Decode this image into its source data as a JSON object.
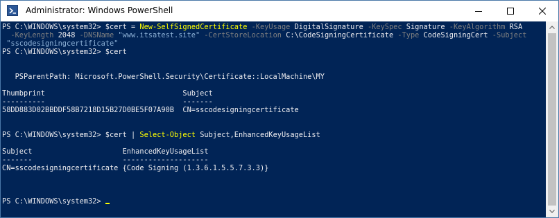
{
  "window": {
    "title": "Administrator: Windows PowerShell",
    "icon": "powershell-icon",
    "controls": [
      "minimize-icon",
      "maximize-icon",
      "close-icon"
    ]
  },
  "colors": {
    "background": "#012456",
    "command": "#ffff00",
    "parameter": "#808080",
    "text": "#eeedf0",
    "string": "#8fb3d8"
  },
  "console": {
    "cmd1": {
      "prompt": "PS C:\\WINDOWS\\system32> ",
      "var": "$cert",
      "eq": " = ",
      "cmdlet": "New-SelfSignedCertificate",
      "p_keyusage": " -KeyUsage",
      "v_keyusage": " DigitalSignature",
      "p_keyspec": " -KeySpec",
      "v_keyspec": " Signature",
      "p_keyalg": " -KeyAlgorithm",
      "v_keyalg": " RSA",
      "p_keylength": " -KeyLength",
      "v_keylength": " 2048",
      "p_dnsname": " -DNSName",
      "v_dnsname": " \"www.itsatest.site\"",
      "p_certstore": " -CertStoreLocation",
      "v_certstore": " C:\\CodeSigningCertificate",
      "p_type": " -Type",
      "v_type": " CodeSigningCert",
      "p_subject": " -Subject",
      "v_subject": "\"sscodesigningcertificate\""
    },
    "cmd2": {
      "prompt": "PS C:\\WINDOWS\\system32> ",
      "var": "$cert"
    },
    "ps_parent_path": "   PSParentPath: Microsoft.PowerShell.Security\\Certificate::LocalMachine\\MY",
    "table1": {
      "header": "Thumbprint                                Subject",
      "underline": "----------                                -------",
      "row": "58DD883D02BBDDF58B7218D15B27D0BE5F07A90B  CN=sscodesigningcertificate"
    },
    "cmd3": {
      "prompt": "PS C:\\WINDOWS\\system32> ",
      "var": "$cert",
      "pipe": " | ",
      "cmdlet": "Select-Object",
      "args": " Subject,EnhancedKeyUsageList"
    },
    "table2": {
      "header": "Subject                     EnhancedKeyUsageList",
      "underline": "-------                     --------------------",
      "row": "CN=sscodesigningcertificate {Code Signing (1.3.6.1.5.5.7.3.3)}"
    },
    "cmd4": {
      "prompt": "PS C:\\WINDOWS\\system32> "
    }
  }
}
